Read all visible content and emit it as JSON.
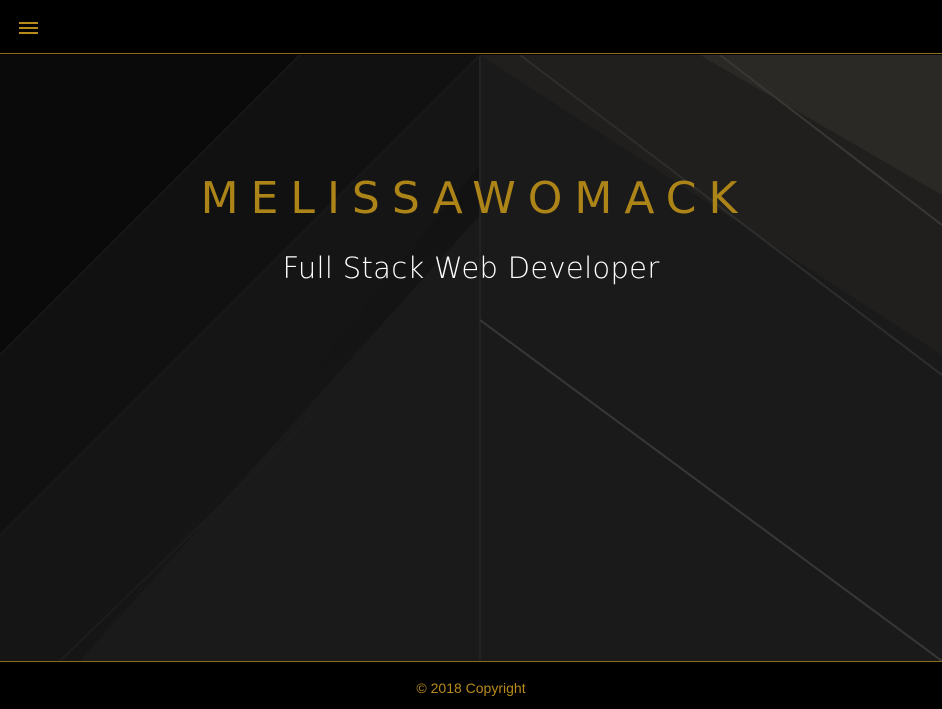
{
  "navbar": {
    "menu_icon": "hamburger-menu-icon"
  },
  "hero": {
    "title": "MELISSAWOMACK",
    "subtitle": "Full Stack Web Developer"
  },
  "footer": {
    "copyright": "© 2018 Copyright"
  },
  "colors": {
    "accent": "#b78a1c",
    "background": "#000000",
    "hero_text": "#ffffff"
  }
}
